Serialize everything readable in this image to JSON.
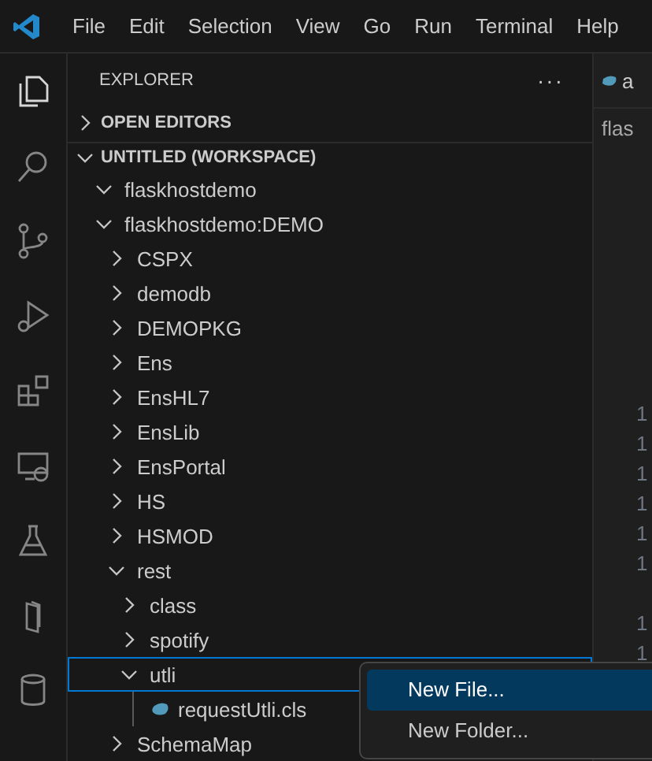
{
  "menu_bar": {
    "items": [
      "File",
      "Edit",
      "Selection",
      "View",
      "Go",
      "Run",
      "Terminal",
      "Help"
    ]
  },
  "activity_bar": {
    "items": [
      {
        "kind": "files",
        "selected": true
      },
      {
        "kind": "search",
        "selected": false
      },
      {
        "kind": "source-control",
        "selected": false
      },
      {
        "kind": "run-debug",
        "selected": false
      },
      {
        "kind": "extensions",
        "selected": false
      },
      {
        "kind": "remote",
        "selected": false
      },
      {
        "kind": "testing",
        "selected": false
      },
      {
        "kind": "panel",
        "selected": false
      },
      {
        "kind": "database",
        "selected": false
      }
    ]
  },
  "explorer": {
    "title": "EXPLORER",
    "more": "···",
    "sections": [
      {
        "title": "OPEN EDITORS",
        "expanded": false
      },
      {
        "title": "UNTITLED (WORKSPACE)",
        "expanded": true
      }
    ],
    "tree": [
      {
        "label": "flaskhostdemo",
        "kind": "folder",
        "expanded": true,
        "focused": false
      },
      {
        "label": "flaskhostdemo:DEMO",
        "kind": "folder",
        "expanded": true,
        "focused": false,
        "children": [
          {
            "label": "CSPX",
            "kind": "folder",
            "expanded": false,
            "focused": false
          },
          {
            "label": "demodb",
            "kind": "folder",
            "expanded": false,
            "focused": false
          },
          {
            "label": "DEMOPKG",
            "kind": "folder",
            "expanded": false,
            "focused": false
          },
          {
            "label": "Ens",
            "kind": "folder",
            "expanded": false,
            "focused": false
          },
          {
            "label": "EnsHL7",
            "kind": "folder",
            "expanded": false,
            "focused": false
          },
          {
            "label": "EnsLib",
            "kind": "folder",
            "expanded": false,
            "focused": false
          },
          {
            "label": "EnsPortal",
            "kind": "folder",
            "expanded": false,
            "focused": false
          },
          {
            "label": "HS",
            "kind": "folder",
            "expanded": false,
            "focused": false
          },
          {
            "label": "HSMOD",
            "kind": "folder",
            "expanded": false,
            "focused": false
          },
          {
            "label": "rest",
            "kind": "folder",
            "expanded": true,
            "focused": false,
            "children": [
              {
                "label": "class",
                "kind": "folder",
                "expanded": false,
                "focused": false
              },
              {
                "label": "spotify",
                "kind": "folder",
                "expanded": false,
                "focused": false
              },
              {
                "label": "utli",
                "kind": "folder",
                "expanded": true,
                "focused": true,
                "children": [
                  {
                    "label": "requestUtli.cls",
                    "kind": "file",
                    "focused": false
                  }
                ]
              }
            ]
          },
          {
            "label": "SchemaMap",
            "kind": "folder",
            "expanded": false,
            "focused": false
          }
        ]
      }
    ]
  },
  "editor": {
    "tab": "a",
    "breadcrumb": "flas",
    "line_numbers": [
      "1",
      "1",
      "1",
      "1",
      "1",
      "1",
      "1",
      "1"
    ]
  },
  "context_menu": {
    "items": [
      {
        "label": "New File...",
        "selected": true
      },
      {
        "label": "New Folder...",
        "selected": false
      }
    ]
  }
}
